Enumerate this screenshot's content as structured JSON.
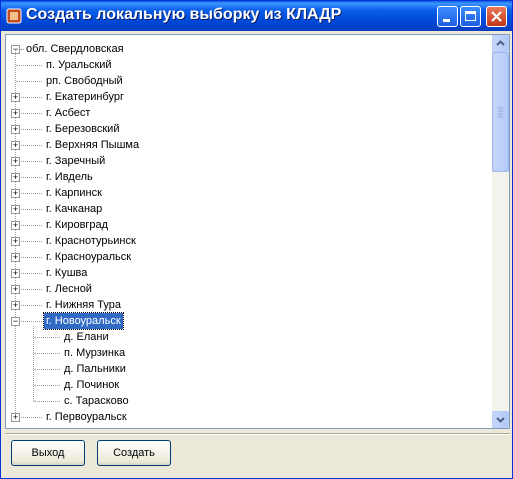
{
  "window": {
    "title": "Создать локальную выборку из КЛАДР"
  },
  "tree": {
    "root": {
      "label": "обл. Свердловская",
      "expanded": true
    },
    "items": [
      {
        "label": "п. Уральский",
        "level": 1,
        "toggle": "none"
      },
      {
        "label": "рп. Свободный",
        "level": 1,
        "toggle": "none"
      },
      {
        "label": "г. Екатеринбург",
        "level": 1,
        "toggle": "plus"
      },
      {
        "label": "г. Асбест",
        "level": 1,
        "toggle": "plus"
      },
      {
        "label": "г. Березовский",
        "level": 1,
        "toggle": "plus"
      },
      {
        "label": "г. Верхняя Пышма",
        "level": 1,
        "toggle": "plus"
      },
      {
        "label": "г. Заречный",
        "level": 1,
        "toggle": "plus"
      },
      {
        "label": "г. Ивдель",
        "level": 1,
        "toggle": "plus"
      },
      {
        "label": "г. Карпинск",
        "level": 1,
        "toggle": "plus"
      },
      {
        "label": "г. Качканар",
        "level": 1,
        "toggle": "plus"
      },
      {
        "label": "г. Кировград",
        "level": 1,
        "toggle": "plus"
      },
      {
        "label": "г. Краснотурьинск",
        "level": 1,
        "toggle": "plus"
      },
      {
        "label": "г. Красноуральск",
        "level": 1,
        "toggle": "plus"
      },
      {
        "label": "г. Кушва",
        "level": 1,
        "toggle": "plus"
      },
      {
        "label": "г. Лесной",
        "level": 1,
        "toggle": "plus"
      },
      {
        "label": "г. Нижняя Тура",
        "level": 1,
        "toggle": "plus"
      },
      {
        "label": "г. Новоуральск",
        "level": 1,
        "toggle": "minus",
        "selected": true
      },
      {
        "label": "д. Елани",
        "level": 2,
        "toggle": "none"
      },
      {
        "label": "п. Мурзинка",
        "level": 2,
        "toggle": "none"
      },
      {
        "label": "д. Пальники",
        "level": 2,
        "toggle": "none"
      },
      {
        "label": "д. Починок",
        "level": 2,
        "toggle": "none"
      },
      {
        "label": "с. Тарасково",
        "level": 2,
        "toggle": "none"
      },
      {
        "label": "г. Первоуральск",
        "level": 1,
        "toggle": "plus"
      }
    ]
  },
  "buttons": {
    "exit": "Выход",
    "create": "Создать"
  }
}
